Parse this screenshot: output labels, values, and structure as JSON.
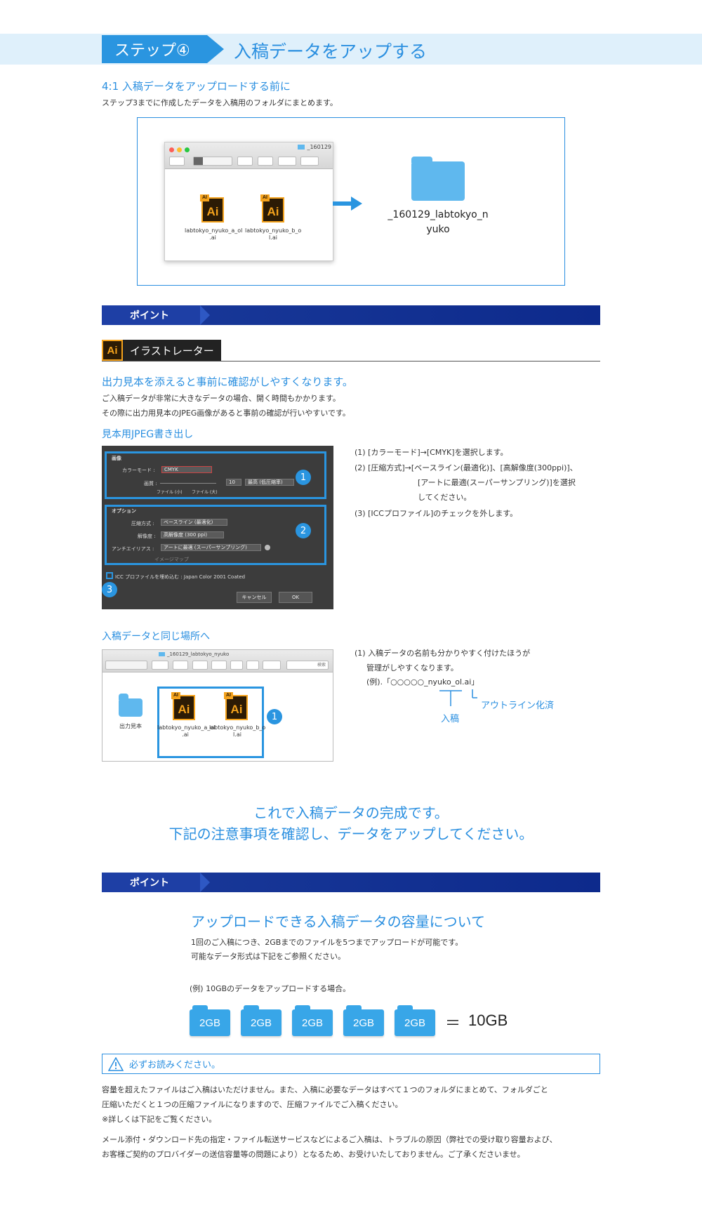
{
  "step": {
    "tag": "ステップ④",
    "title": "入稿データをアップする"
  },
  "section1": {
    "title": "4:1 入稿データをアップロードする前に",
    "desc": "ステップ3までに作成したデータを入稿用のフォルダにまとめます。"
  },
  "figure1": {
    "window_title": "_160129",
    "file1": "labtokyo_nyuko_a_ol\n.ai",
    "file2": "labtokyo_nyuko_b_o\nl.ai",
    "folder_label": "_160129_labtokyo_n\nyuko",
    "ai_label": "Ai",
    "ai_tag": "AI"
  },
  "point1": {
    "label": "ポイント"
  },
  "illustrator": {
    "icon": "Ai",
    "label": "イラストレーター"
  },
  "section2": {
    "title": "出力見本を添えると事前に確認がしやすくなります。",
    "line1": "ご入稿データが非常に大きなデータの場合、開く時間もかかります。",
    "line2": "その際に出力用見本のJPEG画像があると事前の確認が行いやすいです。",
    "subtitle": "見本用JPEG書き出し"
  },
  "dialog": {
    "group1": "画像",
    "color_mode_label": "カラーモード :",
    "color_mode_value": "CMYK",
    "quality_label": "画質 :",
    "quality_value": "10",
    "quality_select": "最高 (低圧縮率)",
    "small_file": "ファイル (小)",
    "large_file": "ファイル (大)",
    "group2": "オプション",
    "compression_label": "圧縮方式 :",
    "compression_value": "ベースライン (最適化)",
    "resolution_label": "解像度 :",
    "resolution_value": "高解像度 (300 ppi)",
    "antialias_label": "アンチエイリアス :",
    "antialias_value": "アートに最適 (スーパーサンプリング)",
    "imagemap": "イメージマップ",
    "icc": "ICC プロファイルを埋め込む : Japan Color 2001 Coated",
    "cancel": "キャンセル",
    "ok": "OK",
    "badge1": "1",
    "badge2": "2",
    "badge3": "3"
  },
  "instructions": {
    "s1": "(1) [カラーモード]→[CMYK]を選択します。",
    "s2a": "(2) [圧縮方式]→[ベースライン(最適化)]、[高解像度(300ppi)]、",
    "s2b": "[アートに最適(スーパーサンプリング)]を選択",
    "s2c": "してください。",
    "s3": "(3) [ICCプロファイル]のチェックを外します。"
  },
  "section3": {
    "subtitle": "入稿データと同じ場所へ"
  },
  "finder2": {
    "window_title": "_160129_labtokyo_nyuko",
    "search": "検索",
    "sample_folder": "出力見本",
    "file1": "labtokyo_nyuko_a_ol\n.ai",
    "file2": "labtokyo_nyuko_b_o\nl.ai",
    "badge": "1"
  },
  "naming": {
    "l1": "(1) 入稿データの名前も分かりやすく付けたほうが",
    "l2": "管理がしやすくなります。",
    "l3": "(例).「○○○○○_nyuko_ol.ai」",
    "outline": "アウトライン化済",
    "nyuko": "入稿"
  },
  "done": {
    "line1": "これで入稿データの完成です。",
    "line2": "下記の注意事項を確認し、データをアップしてください。"
  },
  "point2": {
    "label": "ポイント"
  },
  "capacity": {
    "title": "アップロードできる入稿データの容量について",
    "line1": "1回のご入稿につき、2GBまでのファイルを5つまでアップロードが可能です。",
    "line2": "可能なデータ形式は下記をご参照ください。",
    "example": "(例) 10GBのデータをアップロードする場合。",
    "chunks": [
      "2GB",
      "2GB",
      "2GB",
      "2GB",
      "2GB"
    ],
    "equals": "＝",
    "total": "10GB"
  },
  "notice": {
    "title": "必ずお読みください。",
    "p1": "容量を超えたファイルはご入稿はいただけません。また、入稿に必要なデータはすべて１つのフォルダにまとめて、フォルダごと",
    "p2": "圧縮いただくと１つの圧縮ファイルになりますので、圧縮ファイルでご入稿ください。",
    "p3": "※詳しくは下記をご覧ください。",
    "p4": "メール添付・ダウンロード先の指定・ファイル転送サービスなどによるご入稿は、トラブルの原因（弊社での受け取り容量および、",
    "p5": "お客様ご契約のプロバイダーの送信容量等の問題により）となるため、お受けいたしておりません。ご了承くださいませ。"
  },
  "colors": {
    "accent": "#2a8fe0",
    "navy": "#0d2a8c",
    "ai_orange": "#f4a21c"
  }
}
